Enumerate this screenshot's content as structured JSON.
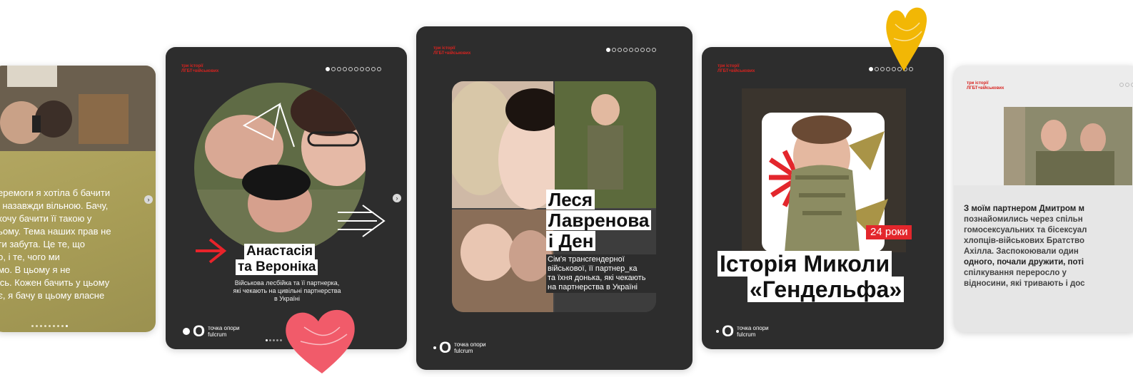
{
  "colors": {
    "card_dark": "#2d2d2d",
    "accent_red": "#d8231f",
    "heart_pink": "#f15b6a",
    "heart_yellow": "#f2b705",
    "olive": "#b1a758"
  },
  "card1": {
    "text_lines": [
      "перемоги я хотіла б бачити",
      "ю назавжди вільною. Бачу,",
      "і хочу бачити її такою у",
      "ньому. Тема наших прав не",
      "ути забута. Це те, що",
      "но, і те, чого ми",
      "емо. В цьому я не",
      "юсь. Кожен бачить у цьому",
      "оє, я бачу в цьому власне"
    ],
    "next_icon": "chevron-right-icon"
  },
  "card2": {
    "tag": "три історії\nЛГБТ+військових",
    "dots_total": 10,
    "dots_active": 0,
    "title_line1": "Анастасія",
    "title_line2": "та Вероніка",
    "subtitle": "Військова лесбійка та її партнерка,\nякі чекають на цивільні партнерства\nв Україні",
    "logo_mark": "O",
    "logo_text": "точка опори\nfulcrum",
    "next_icon": "chevron-right-icon"
  },
  "card3": {
    "tag": "три історії\nЛГБТ+військових",
    "dots_total": 9,
    "dots_active": 0,
    "title_line1": "Леся",
    "title_line2": "Лавренова",
    "title_line3": "і Ден",
    "subtitle": "Сім'я трансгендерної\nвійськової, її партнер_ка\nта їхня донька, які чекають\nна партнерства в Україні",
    "logo_mark": "O",
    "logo_text": "точка опори\nfulcrum"
  },
  "card4": {
    "tag": "три історії\nЛГБТ+військових",
    "dots_total": 8,
    "dots_active": 0,
    "age_badge": "24 роки",
    "title_line1": "Історія Миколи",
    "title_line2": "«Гендельфа»",
    "logo_mark": "O",
    "logo_text": "точка опори\nfulcrum"
  },
  "card5": {
    "tag": "три історії\nЛГБТ+військових",
    "text_lines": [
      "З моїм партнером Дмитром м",
      "познайомились через спільн",
      "гомосексуальних та бісексуал",
      "хлопців-військових Братство",
      "Ахілла. Заспокоювали один",
      "одного, почали дружити, поті",
      "спілкування переросло у",
      "відносини, які тривають і дос"
    ]
  }
}
